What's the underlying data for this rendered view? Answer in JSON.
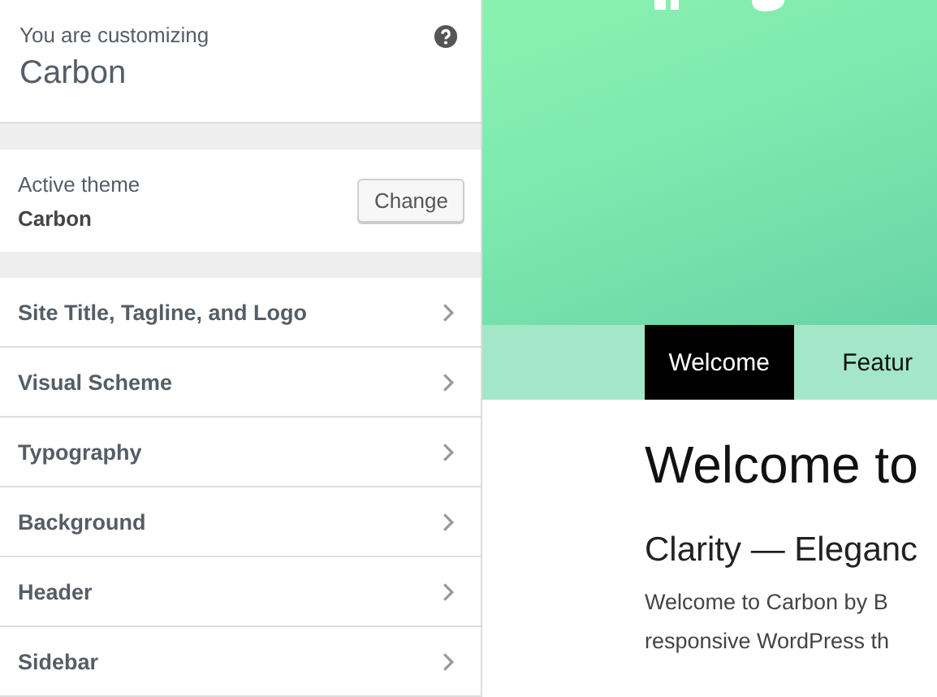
{
  "header": {
    "label": "You are customizing",
    "title": "Carbon"
  },
  "active_theme": {
    "label": "Active theme",
    "name": "Carbon",
    "button": "Change"
  },
  "sections": [
    {
      "label": "Site Title, Tagline, and Logo"
    },
    {
      "label": "Visual Scheme"
    },
    {
      "label": "Typography"
    },
    {
      "label": "Background"
    },
    {
      "label": "Header"
    },
    {
      "label": "Sidebar"
    }
  ],
  "preview": {
    "nav": [
      {
        "label": "Welcome",
        "selected": true
      },
      {
        "label": "Featur",
        "selected": false
      }
    ],
    "heading": "Welcome to",
    "subheading": "Clarity — Eleganc",
    "paragraph": [
      "Welcome to Carbon by B",
      "responsive WordPress th"
    ]
  }
}
